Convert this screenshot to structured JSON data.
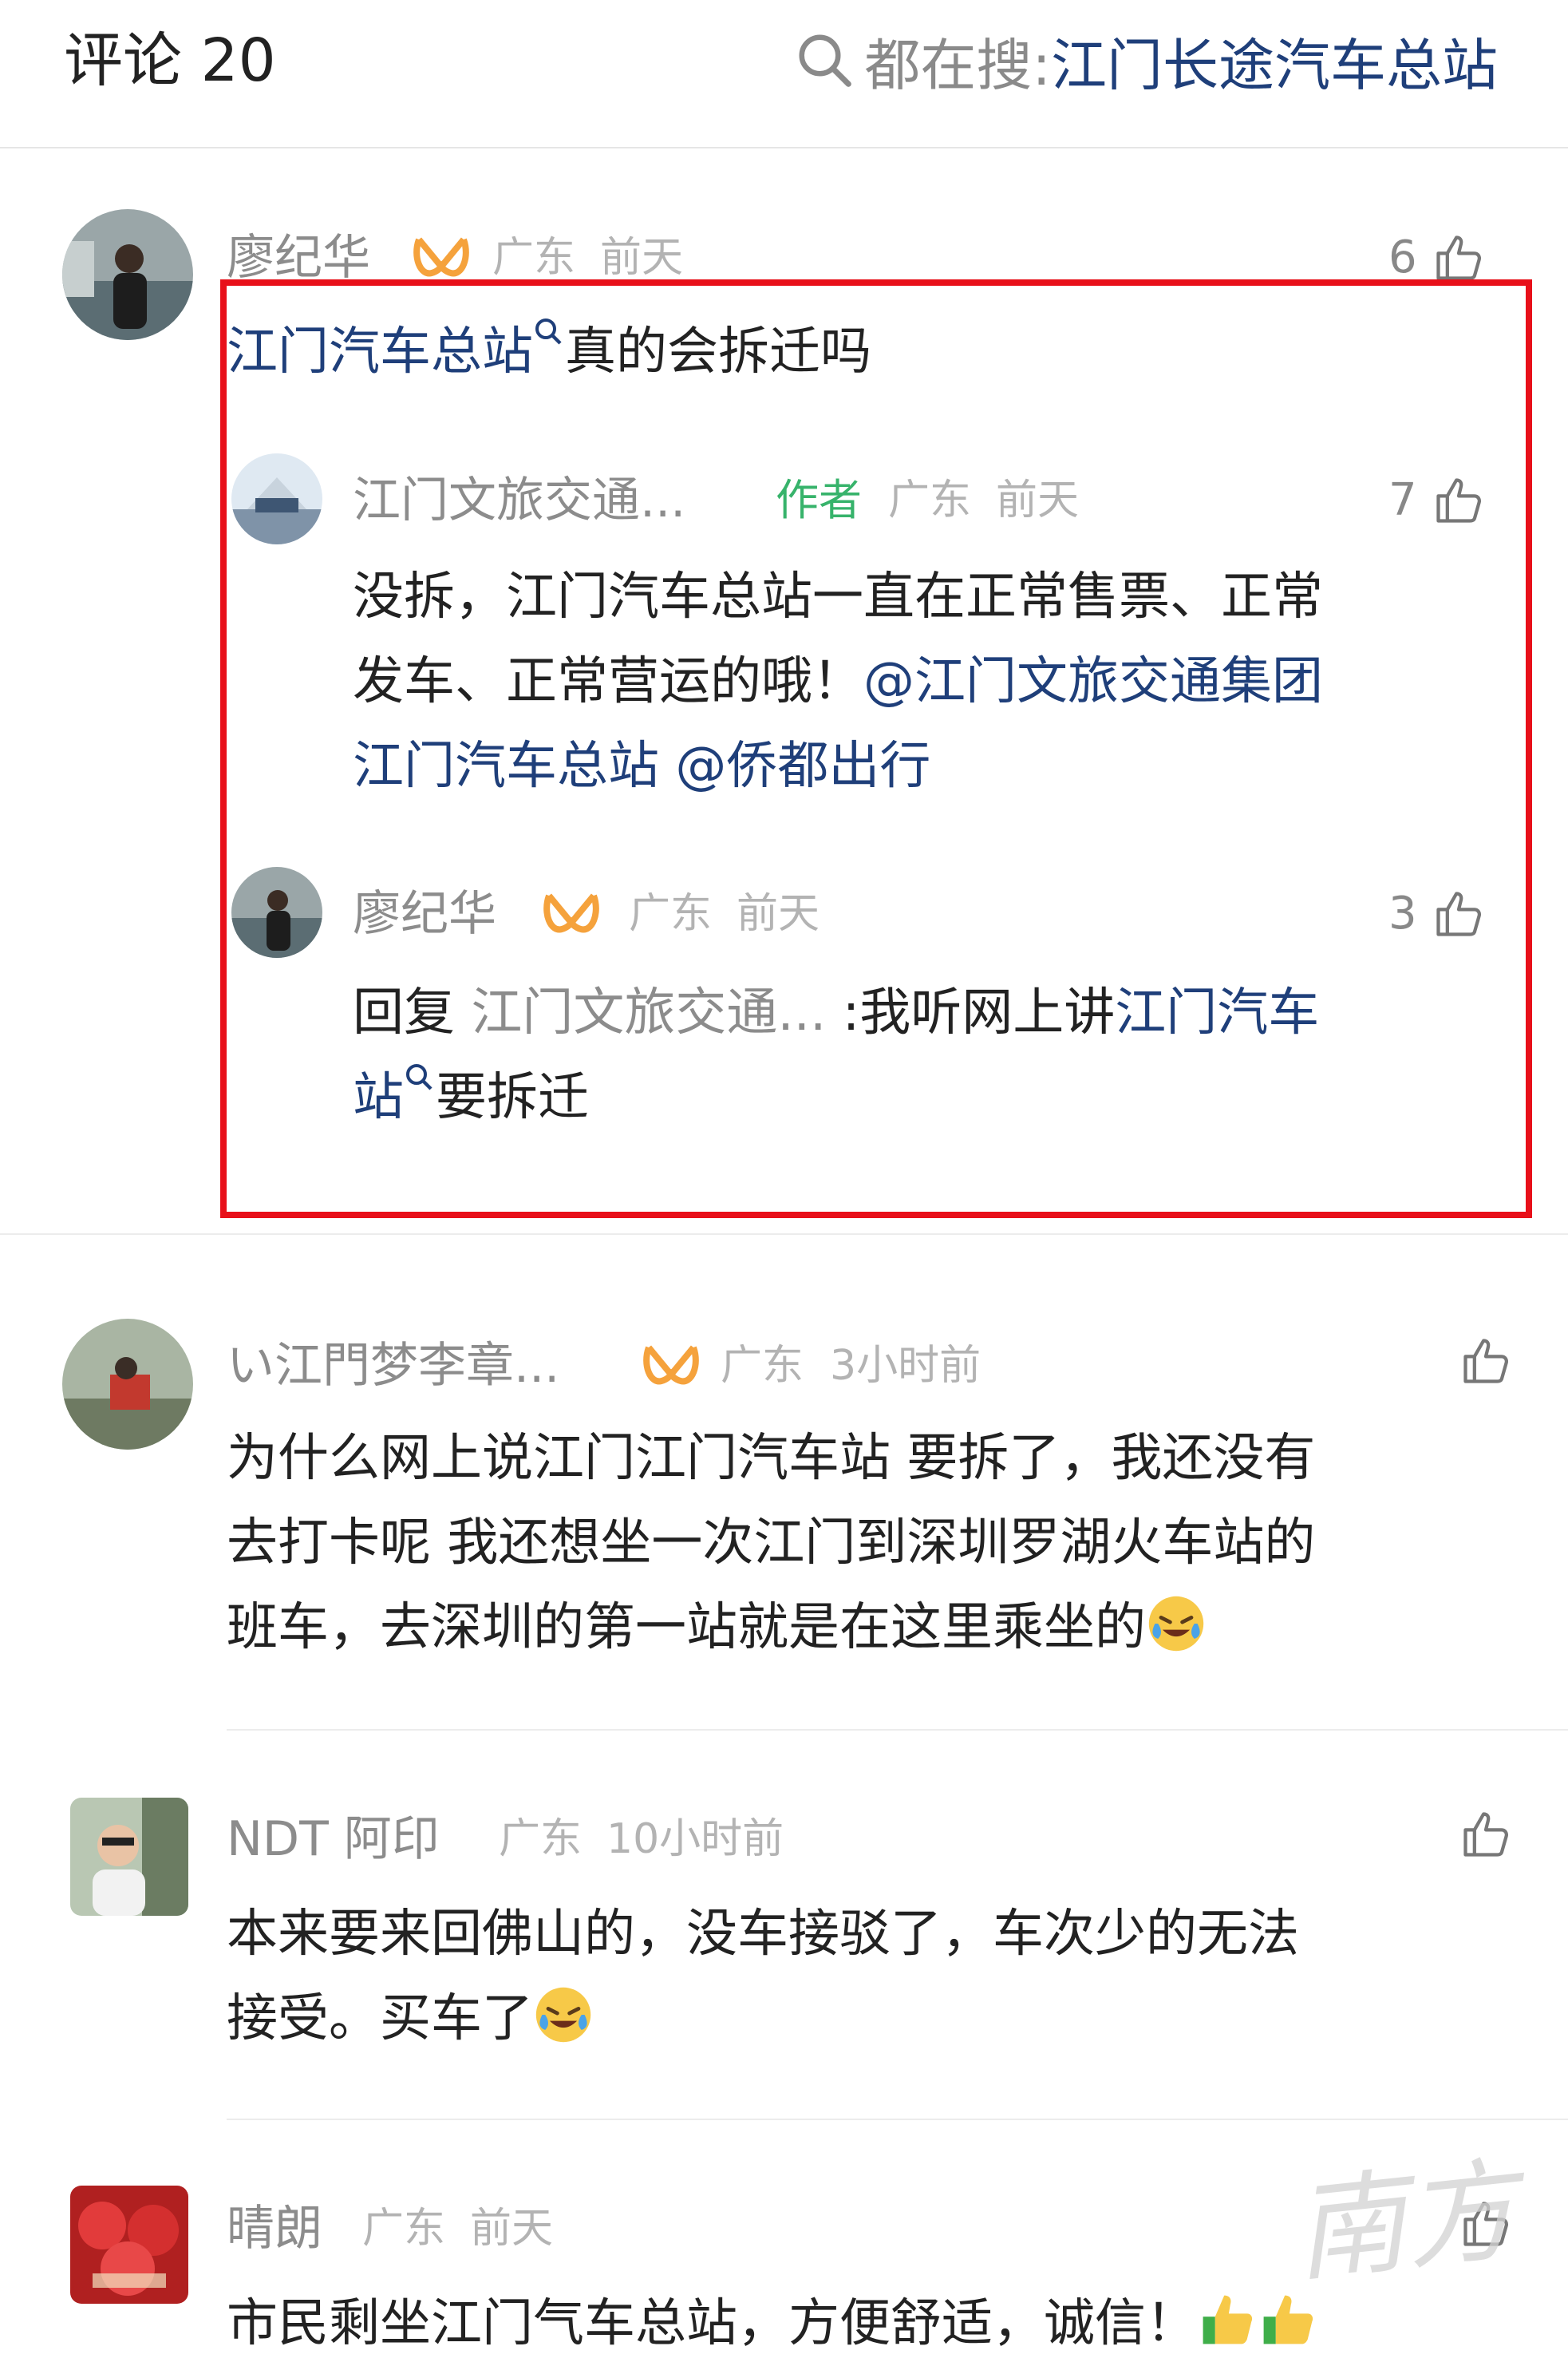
{
  "header": {
    "title": "评论 20",
    "search_prefix": "都在搜:",
    "search_term": "江门长途汽车总站"
  },
  "comments": [
    {
      "user": "廖纪华",
      "location": "广东",
      "time": "前天",
      "likes": "6",
      "text_link": "江门汽车总站",
      "text_rest": "真的会拆迁吗",
      "replies": [
        {
          "user": "江门文旅交通...",
          "tag": "作者",
          "location": "广东",
          "time": "前天",
          "likes": "7",
          "line1": "没拆，江门汽车总站一直在正常售票、正常",
          "line2_text": "发车、正常营运的哦！",
          "line2_link": "@江门文旅交通集团",
          "line3_link": "江门汽车总站 @侨都出行"
        },
        {
          "user": "廖纪华",
          "location": "广东",
          "time": "前天",
          "likes": "3",
          "reply_prefix": "回复",
          "reply_to": "江门文旅交通...",
          "reply_text": ":我听网上讲",
          "link_part1": "江门汽车",
          "link_part2": "站",
          "rest": "要拆迁"
        }
      ]
    },
    {
      "user": "い江門梦李章...",
      "location": "广东",
      "time": "3小时前",
      "line1": "为什么网上说江门江门汽车站 要拆了，我还没有",
      "line2": "去打卡呢 我还想坐一次江门到深圳罗湖火车站的",
      "line3": "班车，去深圳的第一站就是在这里乘坐的"
    },
    {
      "user": "NDT 阿印",
      "location": "广东",
      "time": "10小时前",
      "line1": "本来要来回佛山的，没车接驳了，车次少的无法",
      "line2": "接受。买车了"
    },
    {
      "user": "晴朗",
      "location": "广东",
      "time": "前天",
      "line1": "市民剩坐江门气车总站，方便舒适，诚信！"
    }
  ],
  "watermark": "南方",
  "icons": {
    "search": "search-icon",
    "like": "thumbs-up-icon",
    "badge": "orange-badge-icon",
    "search_hint": "magnifier-small-icon",
    "emoji_cry_laugh": "crying-laughing-emoji-icon",
    "emoji_thumbs": "thumbs-up-emoji-icon"
  },
  "colors": {
    "link": "#1f3f7a",
    "author_tag": "#37b36b",
    "highlight_box": "#e8101a",
    "badge": "#f5a23c"
  }
}
